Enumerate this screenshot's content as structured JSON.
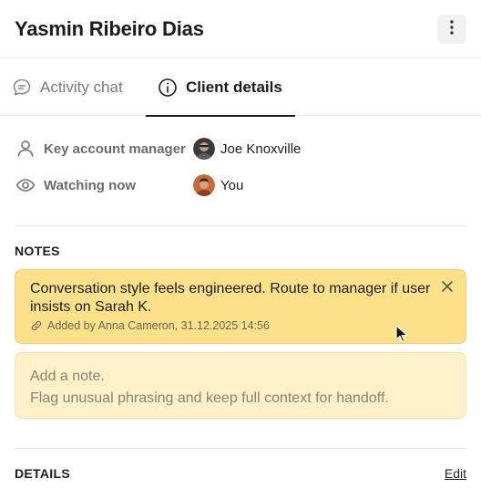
{
  "header": {
    "title": "Yasmin Ribeiro Dias",
    "more_icon": "more-vertical-icon"
  },
  "tabs": [
    {
      "label": "Activity chat",
      "icon": "chat-bubble-icon",
      "active": false
    },
    {
      "label": "Client details",
      "icon": "info-circle-icon",
      "active": true
    }
  ],
  "info": {
    "key_account_manager": {
      "label": "Key account manager",
      "icon": "user-icon",
      "value": "Joe Knoxville"
    },
    "watching_now": {
      "label": "Watching now",
      "icon": "eye-icon",
      "value": "You"
    }
  },
  "notes": {
    "section_title": "NOTES",
    "pinned_note": {
      "text": "Conversation style feels engineered. Route to manager if user insists on Sarah K.",
      "meta": "Added by Anna Cameron, 31.12.2025 14:56",
      "meta_icon": "link-icon",
      "close_icon": "close-icon"
    },
    "input": {
      "placeholder_line1": "Add a note.",
      "placeholder_line2": "Flag unusual phrasing and keep full context for handoff."
    }
  },
  "details": {
    "section_title": "DETAILS",
    "edit_label": "Edit"
  },
  "colors": {
    "note_bg": "#fde08a",
    "input_bg": "#fef1ca",
    "text": "#1c1c1c",
    "muted": "#6b6b6b"
  }
}
